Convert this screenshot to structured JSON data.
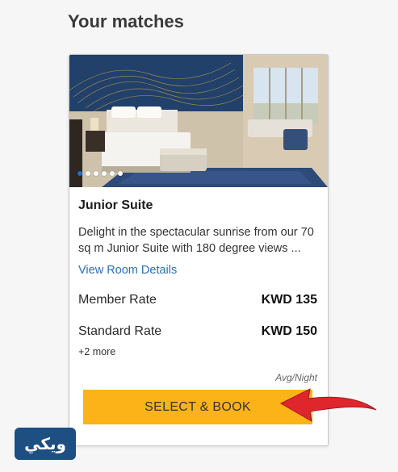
{
  "section_title": "Your matches",
  "room": {
    "name": "Junior Suite",
    "description": "Delight in the spectacular sunrise from our 70 sq m Junior Suite with 180 degree views ...",
    "view_details_label": "View Room Details",
    "rates": [
      {
        "label": "Member Rate",
        "price": "KWD 135"
      },
      {
        "label": "Standard Rate",
        "price": "KWD 150"
      }
    ],
    "more_rates_label": "+2 more",
    "price_unit": "Avg/Night",
    "book_button_label": "SELECT & BOOK",
    "gallery": {
      "total_images": 6,
      "active_index": 1
    }
  },
  "annotation": {
    "arrow_icon": "red-arrow-icon",
    "arrow_color": "#e0262d"
  },
  "watermark": {
    "text": "ويكي",
    "icon": "wiki-logo",
    "background": "#1e4f82"
  },
  "colors": {
    "accent": "#fbb318",
    "link": "#2a6fb5",
    "active_dot": "#1f6fd0"
  }
}
